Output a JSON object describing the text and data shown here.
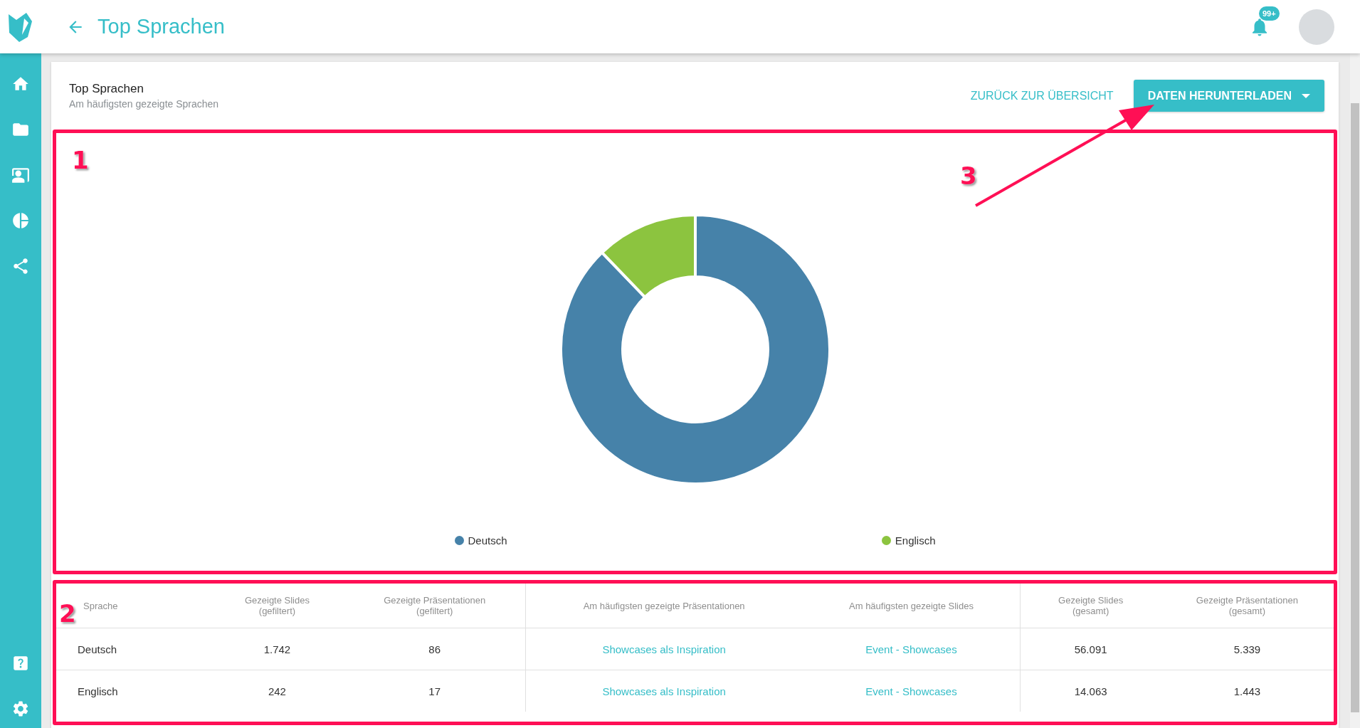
{
  "header": {
    "title": "Top Sprachen",
    "notification_badge": "99+"
  },
  "card": {
    "title": "Top Sprachen",
    "subtitle": "Am häufigsten gezeigte Sprachen",
    "back_link": "ZURÜCK ZUR ÜBERSICHT",
    "download_button": "DATEN HERUNTERLADEN"
  },
  "chart": {
    "chart_data": {
      "type": "donut",
      "categories": [
        "Deutsch",
        "Englisch"
      ],
      "values": [
        87.8,
        12.2
      ]
    },
    "legend": [
      {
        "color": "#4682a9"
      },
      {
        "color": "#8cc43f"
      }
    ]
  },
  "table": {
    "columns": [
      {
        "label": "Sprache",
        "kind": "text"
      },
      {
        "label": "Gezeigte Slides\n(gefiltert)",
        "kind": "number"
      },
      {
        "label": "Gezeigte Präsentationen\n(gefiltert)",
        "kind": "number"
      },
      {
        "label": "Am häufigsten gezeigte Präsentationen",
        "kind": "link"
      },
      {
        "label": "Am häufigsten gezeigte Slides",
        "kind": "link"
      },
      {
        "label": "Gezeigte Slides\n(gesamt)",
        "kind": "number"
      },
      {
        "label": "Gezeigte Präsentationen\n(gesamt)",
        "kind": "number"
      }
    ],
    "rows": [
      [
        "Deutsch",
        "1.742",
        "86",
        "Showcases als Inspiration",
        "Event - Showcases",
        "56.091",
        "5.339"
      ],
      [
        "Englisch",
        "242",
        "17",
        "Showcases als Inspiration",
        "Event - Showcases",
        "14.063",
        "1.443"
      ]
    ]
  },
  "annotations": [
    "1",
    "2",
    "3"
  ]
}
